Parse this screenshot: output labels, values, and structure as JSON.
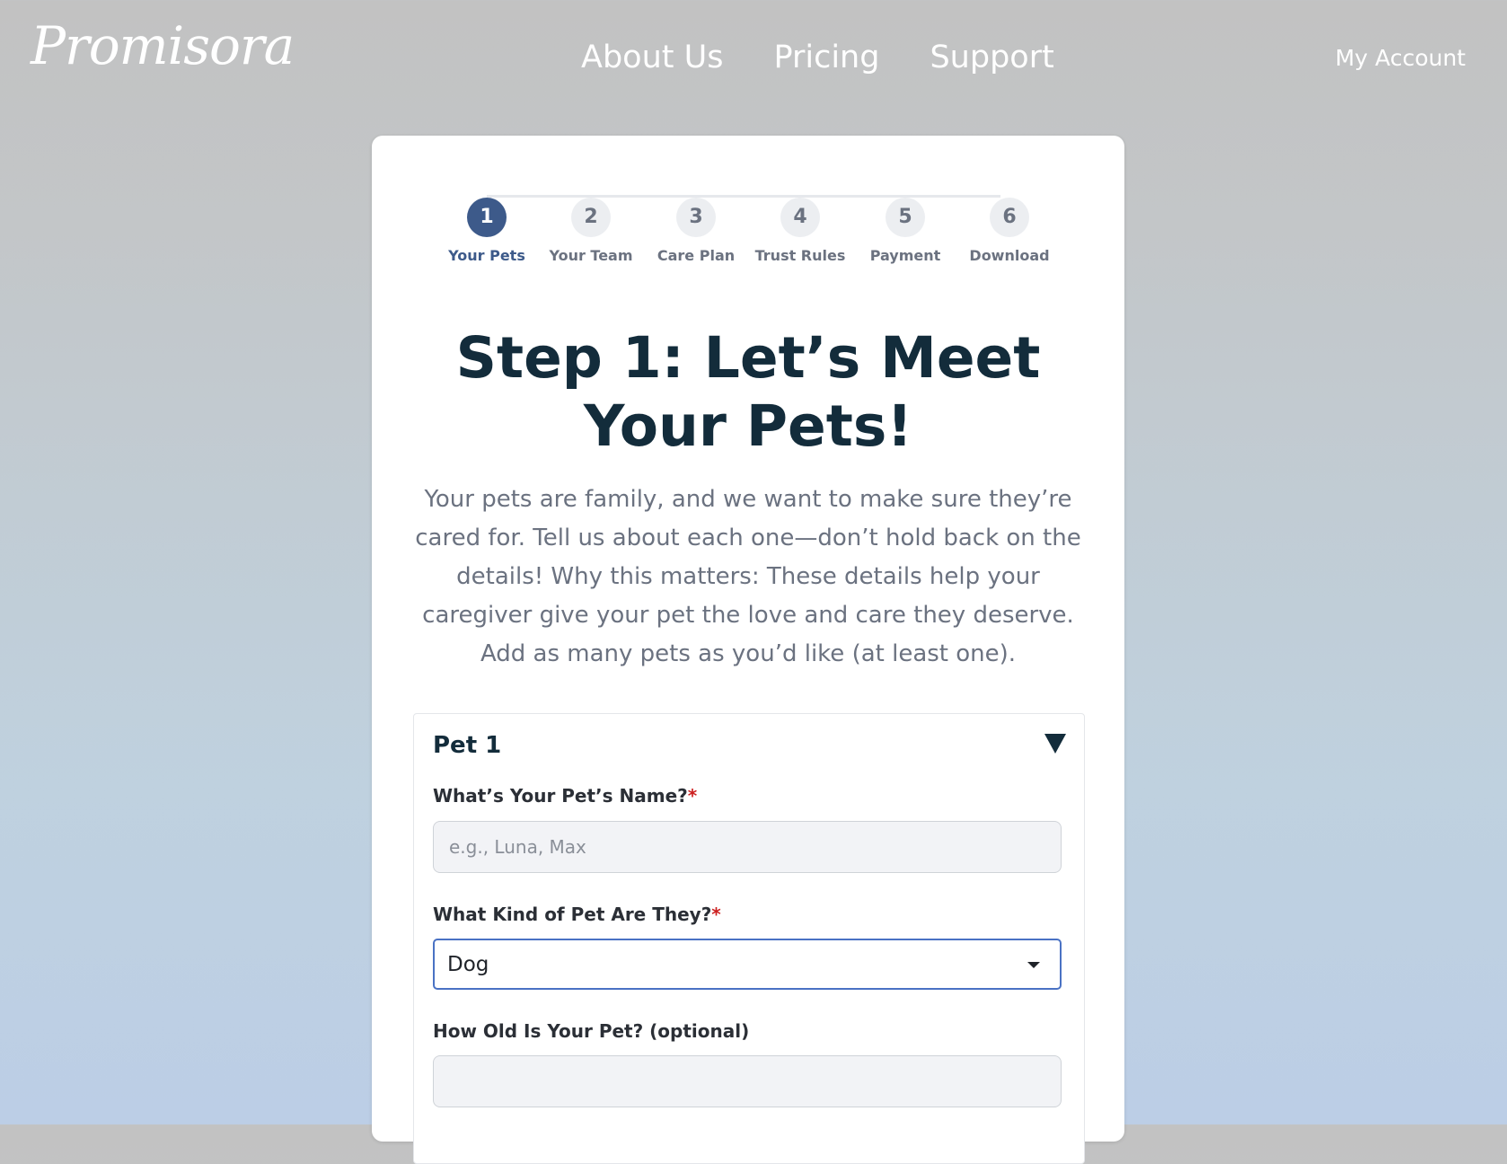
{
  "header": {
    "logo": "Promisora",
    "nav": [
      "About Us",
      "Pricing",
      "Support"
    ],
    "account": "My Account"
  },
  "stepper": {
    "active_step": 1,
    "steps": [
      {
        "number": "1",
        "label": "Your Pets"
      },
      {
        "number": "2",
        "label": "Your Team"
      },
      {
        "number": "3",
        "label": "Care Plan"
      },
      {
        "number": "4",
        "label": "Trust Rules"
      },
      {
        "number": "5",
        "label": "Payment"
      },
      {
        "number": "6",
        "label": "Download"
      }
    ]
  },
  "main": {
    "title": "Step 1: Let’s Meet Your Pets!",
    "intro": "Your pets are family, and we want to make sure they’re cared for. Tell us about each one—don’t hold back on the details! Why this matters: These details help your caregiver give your pet the love and care they deserve. Add as many pets as you’d like (at least one)."
  },
  "pet": {
    "title": "Pet 1",
    "name_label": "What’s Your Pet’s Name?",
    "name_placeholder": "e.g., Luna, Max",
    "name_value": "",
    "kind_label": "What Kind of Pet Are They?",
    "kind_value": "Dog",
    "age_label": "How Old Is Your Pet? (optional)",
    "age_value": "",
    "required_marker": "*"
  },
  "colors": {
    "brand_dark": "#132c3b",
    "accent_blue": "#3d5a8a",
    "required_red": "#cc1f1f",
    "focus_border": "#4a72c4"
  }
}
